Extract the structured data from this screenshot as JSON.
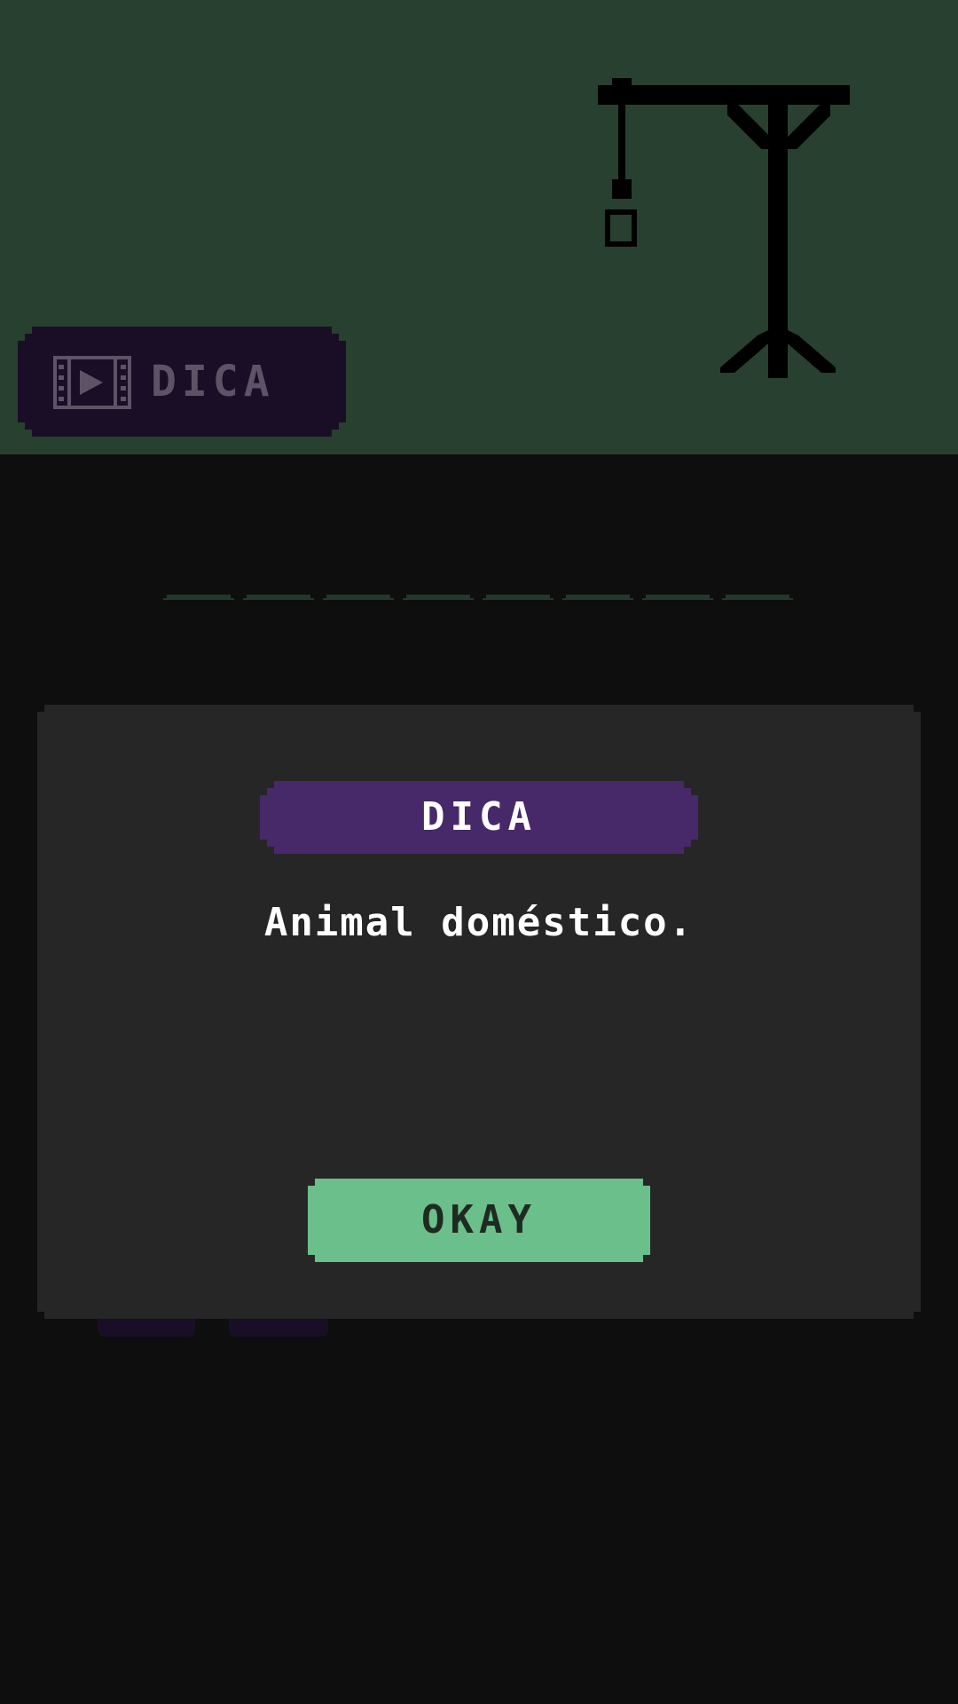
{
  "header": {
    "hint_button_label": "DICA",
    "hint_button_icon": "video-play-icon"
  },
  "word": {
    "letter_count": 8
  },
  "dialog": {
    "title": "DICA",
    "hint": "Animal doméstico.",
    "ok_label": "OKAY"
  },
  "colors": {
    "top_background": "#274030",
    "page_background": "#0e0e0e",
    "dialog_background": "#262626",
    "title_badge": "#47296a",
    "ok_button": "#6bbf8a",
    "hint_button": "#1a0e26"
  }
}
